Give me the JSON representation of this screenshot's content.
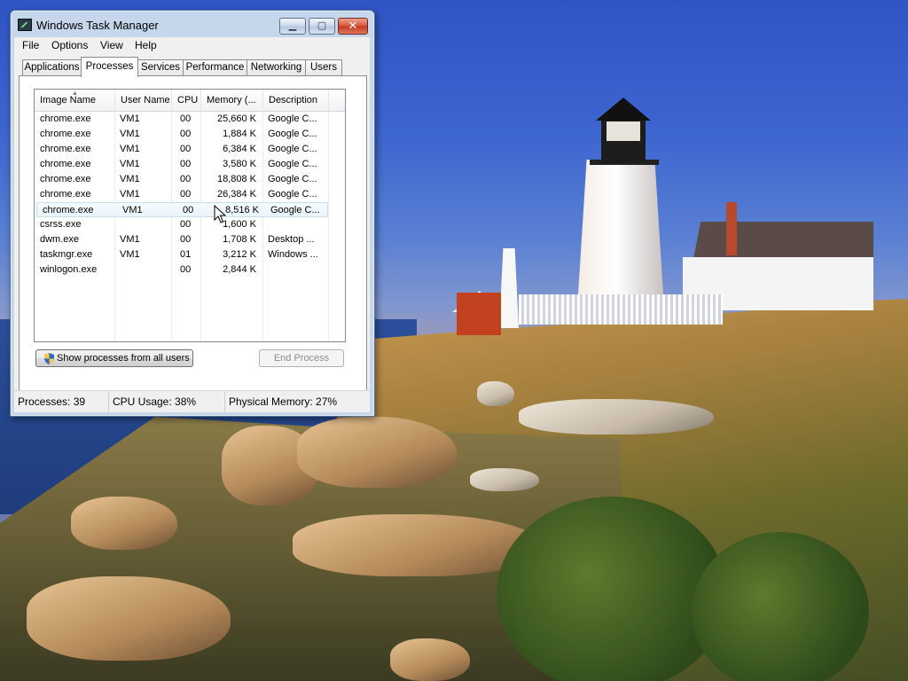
{
  "window": {
    "title": "Windows Task Manager",
    "controls": {
      "minimize": "▁",
      "maximize": "▢",
      "close": "✕"
    }
  },
  "menu": [
    "File",
    "Options",
    "View",
    "Help"
  ],
  "tabs": [
    {
      "label": "Applications",
      "active": false
    },
    {
      "label": "Processes",
      "active": true
    },
    {
      "label": "Services",
      "active": false
    },
    {
      "label": "Performance",
      "active": false
    },
    {
      "label": "Networking",
      "active": false
    },
    {
      "label": "Users",
      "active": false
    }
  ],
  "processes": {
    "columns": [
      "Image Name",
      "User Name",
      "CPU",
      "Memory (...",
      "Description"
    ],
    "sort_indicator": "▲",
    "rows": [
      {
        "name": "chrome.exe",
        "user": "VM1",
        "cpu": "00",
        "memory": "25,660 K",
        "description": "Google C..."
      },
      {
        "name": "chrome.exe",
        "user": "VM1",
        "cpu": "00",
        "memory": "1,884 K",
        "description": "Google C..."
      },
      {
        "name": "chrome.exe",
        "user": "VM1",
        "cpu": "00",
        "memory": "6,384 K",
        "description": "Google C..."
      },
      {
        "name": "chrome.exe",
        "user": "VM1",
        "cpu": "00",
        "memory": "3,580 K",
        "description": "Google C..."
      },
      {
        "name": "chrome.exe",
        "user": "VM1",
        "cpu": "00",
        "memory": "18,808 K",
        "description": "Google C..."
      },
      {
        "name": "chrome.exe",
        "user": "VM1",
        "cpu": "00",
        "memory": "26,384 K",
        "description": "Google C..."
      },
      {
        "name": "chrome.exe",
        "user": "VM1",
        "cpu": "00",
        "memory": "8,516 K",
        "description": "Google C..."
      },
      {
        "name": "csrss.exe",
        "user": "",
        "cpu": "00",
        "memory": "1,600 K",
        "description": ""
      },
      {
        "name": "dwm.exe",
        "user": "VM1",
        "cpu": "00",
        "memory": "1,708 K",
        "description": "Desktop ..."
      },
      {
        "name": "taskmgr.exe",
        "user": "VM1",
        "cpu": "01",
        "memory": "3,212 K",
        "description": "Windows ..."
      },
      {
        "name": "winlogon.exe",
        "user": "",
        "cpu": "00",
        "memory": "2,844 K",
        "description": ""
      }
    ],
    "hovered_row_index": 6,
    "show_all_button": "Show processes from all users",
    "end_process_button": "End Process"
  },
  "status": {
    "processes": "Processes: 39",
    "cpu": "CPU Usage: 38%",
    "memory": "Physical Memory: 27%"
  },
  "colors": {
    "window_frame": "#c6d7ec",
    "close_button": "#c4381e",
    "hover_row": "#eaf4fb",
    "disabled_text": "#8d8d8d"
  },
  "icons": {
    "app": "task-manager-icon",
    "show_all": "uac-shield-icon",
    "pointer": "mouse-cursor-icon"
  }
}
